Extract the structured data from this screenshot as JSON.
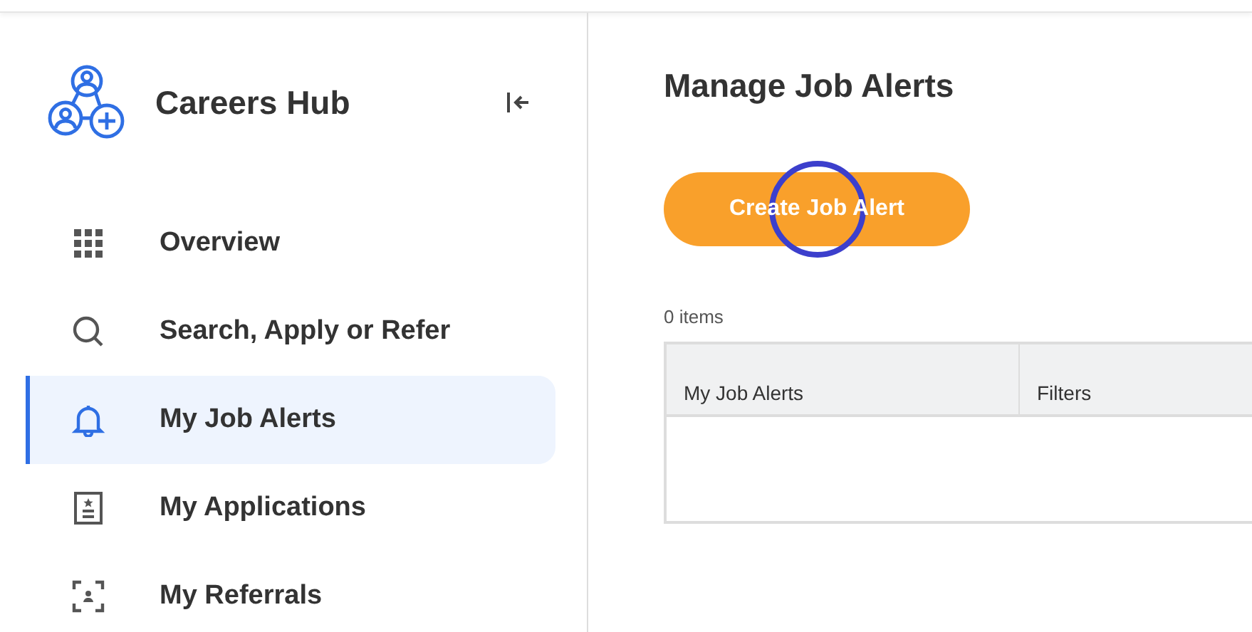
{
  "sidebar": {
    "title": "Careers Hub",
    "items": [
      {
        "label": "Overview",
        "kind": "grid",
        "selected": false
      },
      {
        "label": "Search, Apply or Refer",
        "kind": "search",
        "selected": false
      },
      {
        "label": "My Job Alerts",
        "kind": "bell",
        "selected": true
      },
      {
        "label": "My Applications",
        "kind": "document",
        "selected": false
      },
      {
        "label": "My Referrals",
        "kind": "referral",
        "selected": false
      }
    ]
  },
  "main": {
    "title": "Manage Job Alerts",
    "button": "Create Job Alert",
    "count": "0 items",
    "table": {
      "columns": [
        "My Job Alerts",
        "Filters"
      ]
    }
  }
}
